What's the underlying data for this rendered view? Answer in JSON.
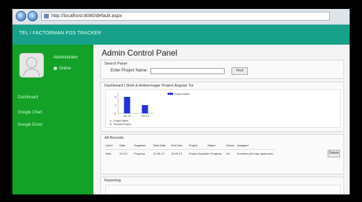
{
  "browser": {
    "url": "http://localhost:8080/default.aspx"
  },
  "header": {
    "title": "TEL / FACTORMAN PDS TRACKER"
  },
  "sidebar": {
    "username": "Administrator",
    "status": "Online",
    "links": [
      "Dashboard",
      "Google Chart",
      "Google Excel"
    ]
  },
  "main": {
    "title": "Admin Control Panel",
    "search_panel": {
      "heading": "Search Panel",
      "label": "Enter Project Name:",
      "input_value": "",
      "button": "Find"
    },
    "dashboard_panel": {
      "heading": "Dashboard | Shell & Ambermager Project Angular Tor"
    },
    "records_panel": {
      "heading": "All Records",
      "columns": [
        "Cm/Id",
        "Date",
        "Organiser",
        "Start Date",
        "End Date",
        "Project",
        "Status",
        "Owner",
        "Assigned"
      ],
      "rows": [
        [
          "Hello",
          "24-5-2",
          "Progress",
          "12-05-13",
          "15-09-13",
          "Project Angular",
          "In Progress",
          "1st",
          "Incentive pilot mgr dashboard"
        ]
      ],
      "row_button": "Delete"
    },
    "reporting_panel": {
      "heading": "Reporting"
    }
  },
  "chart_data": {
    "type": "bar",
    "categories": [
      "Jan-13",
      "Feb-13"
    ],
    "series": [
      {
        "name": "Project Status",
        "values": [
          4,
          2
        ]
      }
    ],
    "ylim": [
      0,
      5
    ],
    "yticks": [
      "4",
      "2",
      "0"
    ],
    "legend_position": "right",
    "notes": [
      "A - Project Status",
      "B - Finished Project"
    ],
    "color": "#2233dd"
  },
  "colors": {
    "header_bg": "#17a18a",
    "sidebar_bg": "#13a127",
    "bar": "#2233dd"
  }
}
